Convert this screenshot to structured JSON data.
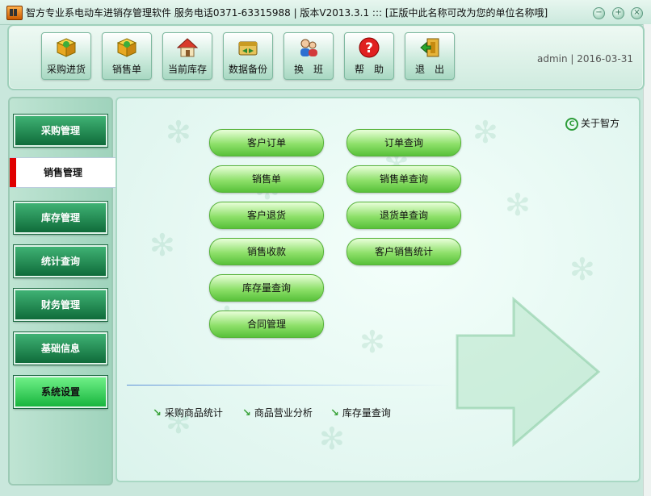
{
  "window": {
    "title": "智方专业系电动车进销存管理软件  服务电话0371-63315988 | 版本V2013.3.1 ::: [正版中此名称可改为您的单位名称哦]",
    "minimize_glyph": "−",
    "maximize_glyph": "+",
    "close_glyph": "×"
  },
  "toolbar": {
    "buttons": [
      {
        "label": "采购进货",
        "icon": "box-icon"
      },
      {
        "label": "销售单",
        "icon": "box-icon"
      },
      {
        "label": "当前库存",
        "icon": "house-icon"
      },
      {
        "label": "数据备份",
        "icon": "backup-icon"
      },
      {
        "label": "换　班",
        "icon": "users-icon"
      },
      {
        "label": "帮　助",
        "icon": "help-icon"
      },
      {
        "label": "退　出",
        "icon": "exit-icon"
      }
    ],
    "user": "admin | 2016-03-31"
  },
  "sidebar": {
    "items": [
      {
        "label": "采购管理"
      },
      {
        "label": "销售管理",
        "active": true
      },
      {
        "label": "库存管理"
      },
      {
        "label": "统计查询"
      },
      {
        "label": "财务管理"
      },
      {
        "label": "基础信息"
      },
      {
        "label": "系统设置"
      }
    ]
  },
  "main": {
    "about": {
      "icon_glyph": "C",
      "label": "关于智方"
    },
    "buttons_left": [
      "客户订单",
      "销售单",
      "客户退货",
      "销售收款",
      "库存量查询",
      "合同管理"
    ],
    "buttons_right": [
      "订单查询",
      "销售单查询",
      "退货单查询",
      "客户销售统计"
    ],
    "links": {
      "arrow": "↘",
      "items": [
        "采购商品统计",
        "商品营业分析",
        "库存量查询"
      ]
    }
  },
  "colors": {
    "accent_green": "#58c13a",
    "active_red": "#e00000",
    "sidebar_dark_green": "#0f6b3a"
  }
}
